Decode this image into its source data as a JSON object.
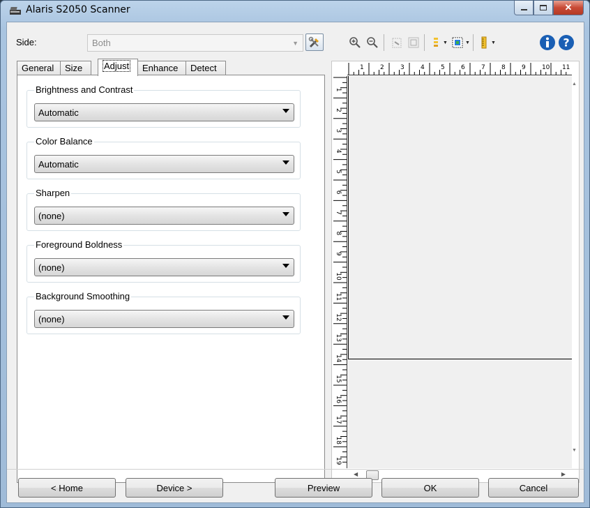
{
  "window": {
    "title": "Alaris S2050 Scanner"
  },
  "side": {
    "label": "Side:",
    "value": "Both"
  },
  "tabs": [
    {
      "label": "General"
    },
    {
      "label": "Size"
    },
    {
      "label": "Adjust",
      "active": true
    },
    {
      "label": "Enhance"
    },
    {
      "label": "Detect"
    }
  ],
  "groups": [
    {
      "label": "Brightness and Contrast",
      "value": "Automatic"
    },
    {
      "label": "Color Balance",
      "value": "Automatic"
    },
    {
      "label": "Sharpen",
      "value": "(none)"
    },
    {
      "label": "Foreground Boldness",
      "value": "(none)"
    },
    {
      "label": "Background Smoothing",
      "value": "(none)"
    }
  ],
  "ruler": {
    "top_numbers": [
      "1",
      "2",
      "3",
      "4",
      "5",
      "6",
      "7",
      "8",
      "9",
      "10",
      "11"
    ],
    "left_numbers": [
      "1",
      "2",
      "3",
      "4",
      "5",
      "6",
      "7",
      "8",
      "9",
      "10",
      "11",
      "12",
      "13",
      "14",
      "15",
      "16",
      "17",
      "18",
      "19"
    ]
  },
  "buttons": {
    "home": "< Home",
    "device": "Device >",
    "preview": "Preview",
    "ok": "OK",
    "cancel": "Cancel"
  },
  "icons": {
    "zoom_in": "zoom-in-icon",
    "zoom_out": "zoom-out-icon",
    "rotate": "rotate-icon",
    "fit": "fit-page-icon",
    "light": "light-icon",
    "color": "color-icon",
    "ruler": "ruler-icon",
    "info": "info-icon",
    "help": "help-icon"
  },
  "colors": {
    "info_blue": "#1a5fb4",
    "accent_yellow": "#f2c230"
  }
}
